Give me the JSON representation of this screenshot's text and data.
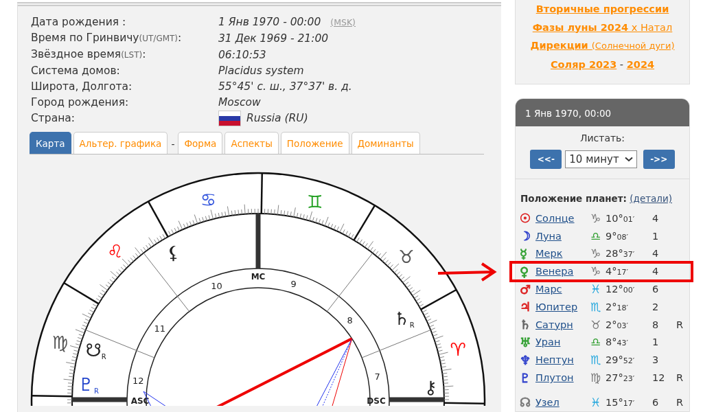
{
  "birth_info": [
    {
      "label": "Дата рождения :",
      "value": "1 Янв 1970 - 00:00",
      "note": "(MSK)"
    },
    {
      "label": "Время по Гринвичу",
      "label_note": "(UT/GMT)",
      "label_end": ":",
      "value": "31 Дек 1969 - 21:00"
    },
    {
      "label": "Звёздное время",
      "label_note": "(LST)",
      "label_end": ":",
      "value": "06:10:53"
    },
    {
      "label": "Система домов:",
      "value": "Placidus system"
    },
    {
      "label": "Широта, Долгота:",
      "value": "55°45' с. ш., 37°37' в. д."
    },
    {
      "label": "Город рождения:",
      "value": "Moscow"
    },
    {
      "label": "Страна:",
      "value": "Russia (RU)",
      "flag": true
    }
  ],
  "tabs": [
    {
      "kind": "tab",
      "label": "Карта",
      "selected": true
    },
    {
      "kind": "tab",
      "label": "Альтер. графика",
      "selected": false
    },
    {
      "kind": "sep",
      "label": "-"
    },
    {
      "kind": "tab",
      "label": "Форма",
      "selected": false
    },
    {
      "kind": "tab",
      "label": "Аспекты",
      "selected": false
    },
    {
      "kind": "tab",
      "label": "Положение",
      "selected": false
    },
    {
      "kind": "tab",
      "label": "Доминанты",
      "selected": false
    }
  ],
  "chart": {
    "signs": [
      {
        "glyph": "♈",
        "color": "#ff0000"
      },
      {
        "glyph": "♉",
        "color": "#555555"
      },
      {
        "glyph": "♊",
        "color": "#22a022"
      },
      {
        "glyph": "♋",
        "color": "#3355dd"
      },
      {
        "glyph": "♌",
        "color": "#ff0000"
      },
      {
        "glyph": "♍",
        "color": "#555555"
      }
    ],
    "houses": [
      "7",
      "8",
      "9",
      "10",
      "11",
      "12"
    ],
    "axes": [
      {
        "kind": "mc",
        "label": "MC"
      },
      {
        "kind": "asc",
        "label": "ASC"
      },
      {
        "kind": "dsc",
        "label": "DSC"
      }
    ],
    "planets": [
      {
        "glyph": "⚸"
      },
      {
        "glyph": "♄",
        "retro": "R"
      },
      {
        "glyph": "☋",
        "retro": "R"
      },
      {
        "glyph": "♇",
        "retro": "R",
        "color": "#2244cc"
      },
      {
        "glyph": "⚷"
      }
    ]
  },
  "top_links": [
    [
      {
        "kind": "bold",
        "text": "Вторичные прогрессии"
      }
    ],
    [
      {
        "kind": "bold",
        "text": "Фазы луны 2024"
      },
      {
        "kind": "normal",
        "text": " x Натал"
      }
    ],
    [
      {
        "kind": "bold",
        "text": "Дирекции "
      },
      {
        "kind": "small",
        "text": "(Солнечной дуги)"
      }
    ],
    [
      {
        "kind": "bold",
        "text": "Соляр 2023"
      },
      {
        "kind": "plain",
        "text": " - "
      },
      {
        "kind": "bold",
        "text": "2024"
      }
    ]
  ],
  "panel": {
    "title": "1 Янв 1970, 00:00",
    "scroll_label": "Листать:",
    "prev": "<<-",
    "next": "->>",
    "step": "10 минут",
    "positions_title": "Положение планет:",
    "details_link": "(детали)",
    "planets": [
      {
        "glyph": "☉",
        "color": "#dd2222",
        "name": "Солнце",
        "sign": {
          "glyph": "♑",
          "color": "#777777"
        },
        "degree": "10°",
        "minutes": "01′",
        "house": "4"
      },
      {
        "glyph": "☽",
        "color": "#3344cc",
        "name": "Луна",
        "sign": {
          "glyph": "♎",
          "color": "#33a033"
        },
        "degree": "9°",
        "minutes": "08′",
        "house": "1"
      },
      {
        "glyph": "☿",
        "color": "#33a033",
        "name": "Мерк",
        "sign": {
          "glyph": "♑",
          "color": "#777777"
        },
        "degree": "28°",
        "minutes": "37′",
        "house": "4"
      },
      {
        "glyph": "♀",
        "color": "#33a033",
        "name": "Венера",
        "sign": {
          "glyph": "♑",
          "color": "#777777"
        },
        "degree": "4°",
        "minutes": "17′",
        "house": "4"
      },
      {
        "glyph": "♂",
        "color": "#dd2222",
        "name": "Марс",
        "sign": {
          "glyph": "♓",
          "color": "#22a6dd"
        },
        "degree": "12°",
        "minutes": "00′",
        "house": "6"
      },
      {
        "glyph": "♃",
        "color": "#dd2222",
        "name": "Юпитер",
        "sign": {
          "glyph": "♏",
          "color": "#22a6dd"
        },
        "degree": "2°",
        "minutes": "18′",
        "house": "2"
      },
      {
        "glyph": "♄",
        "color": "#666666",
        "name": "Сатурн",
        "sign": {
          "glyph": "♉",
          "color": "#777777"
        },
        "degree": "2°",
        "minutes": "03′",
        "house": "8",
        "retro": "R"
      },
      {
        "glyph": "♅",
        "color": "#33a033",
        "name": "Уран",
        "sign": {
          "glyph": "♎",
          "color": "#33a033"
        },
        "degree": "8°",
        "minutes": "43′",
        "house": "1"
      },
      {
        "glyph": "♆",
        "color": "#3344cc",
        "name": "Нептун",
        "sign": {
          "glyph": "♏",
          "color": "#22a6dd"
        },
        "degree": "29°",
        "minutes": "52′",
        "house": "3"
      },
      {
        "glyph": "♇",
        "color": "#3344cc",
        "name": "Плутон",
        "sign": {
          "glyph": "♍",
          "color": "#777777"
        },
        "degree": "27°",
        "minutes": "23′",
        "house": "12",
        "retro": "R"
      }
    ],
    "nodes": [
      {
        "glyph": "☊",
        "color": "#777777",
        "name": "Узел",
        "sign": {
          "glyph": "♓",
          "color": "#22a6dd"
        },
        "degree": "15°",
        "minutes": "17′",
        "house": "6",
        "retro": "R"
      }
    ]
  }
}
